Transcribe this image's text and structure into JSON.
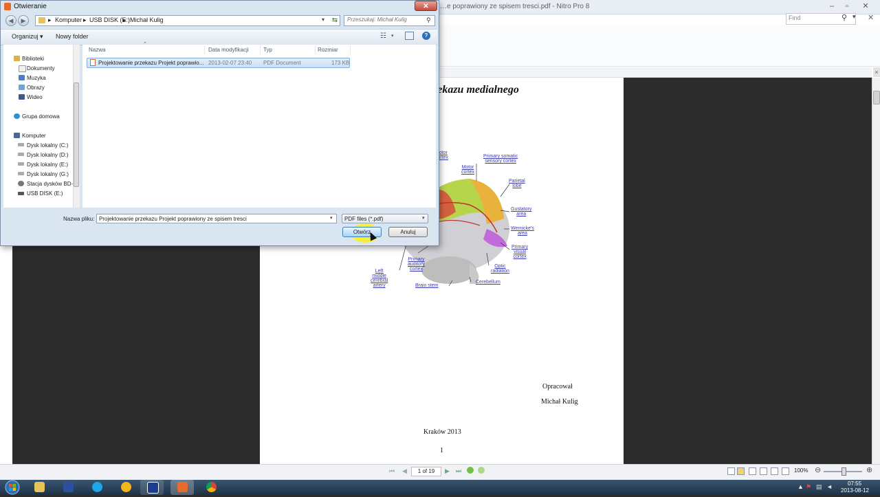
{
  "nitro": {
    "title": "…e poprawiony ze spisem tresci.pdf - Nitro Pro 8",
    "find_placeholder": "Find",
    "doc_title": "zekazu medialnego",
    "brain_labels": [
      "motor\ncortex",
      "Primary somatic\nsensory cortex",
      "Motor\ncortex",
      "Parietal\nlobe",
      "Gustatory\narea",
      "Wernicke's\narea",
      "Primary\nvisual\ncortex",
      "Optic\nradiation",
      "Cerebellum",
      "Brain stem",
      "Primary\nauditory\ncortex",
      "Left\nmiddle\ncerebral\nartery"
    ],
    "prepared_label": "Opracował",
    "author": "Michał Kulig",
    "city_year": "Kraków 2013",
    "page_number": "1",
    "page_indicator": "1 of 19",
    "zoom": "100%"
  },
  "dialog": {
    "title": "Otwieranie",
    "breadcrumbs": [
      "Komputer",
      "USB DISK (E:)",
      "Michał Kulig"
    ],
    "search_placeholder": "Przeszukaj: Michał Kulig",
    "organize_label": "Organizuj ▾",
    "new_folder_label": "Nowy folder",
    "nav": {
      "libraries": "Biblioteki",
      "library_items": [
        "Dokumenty",
        "Muzyka",
        "Obrazy",
        "Wideo"
      ],
      "homegroup": "Grupa domowa",
      "computer": "Komputer",
      "drives": [
        "Dysk lokalny (C:)",
        "Dysk lokalny (D:)",
        "Dysk lokalny (E:)",
        "Dysk lokalny (G:)",
        "Stacja dysków BD-",
        "USB DISK (E:)"
      ]
    },
    "columns": [
      "Nazwa",
      "Data modyfikacji",
      "Typ",
      "Rozmiar"
    ],
    "files": [
      {
        "name": "Projektowanie przekazu Projekt poprawio...",
        "modified": "2013-02-07 23:40",
        "type": "PDF Document",
        "size": "173 KB"
      }
    ],
    "filename_label": "Nazwa pliku:",
    "filename_value": "Projektowanie przekazu Projekt poprawiony ze spisem tresci",
    "filter_value": "PDF files (*.pdf)",
    "open_label": "Otwórz",
    "cancel_label": "Anuluj"
  },
  "taskbar": {
    "time": "07:55",
    "date": "2013-08-12"
  },
  "icons": {
    "back": "back-arrow-icon",
    "forward": "forward-arrow-icon",
    "search": "search-icon",
    "help": "help-icon"
  }
}
